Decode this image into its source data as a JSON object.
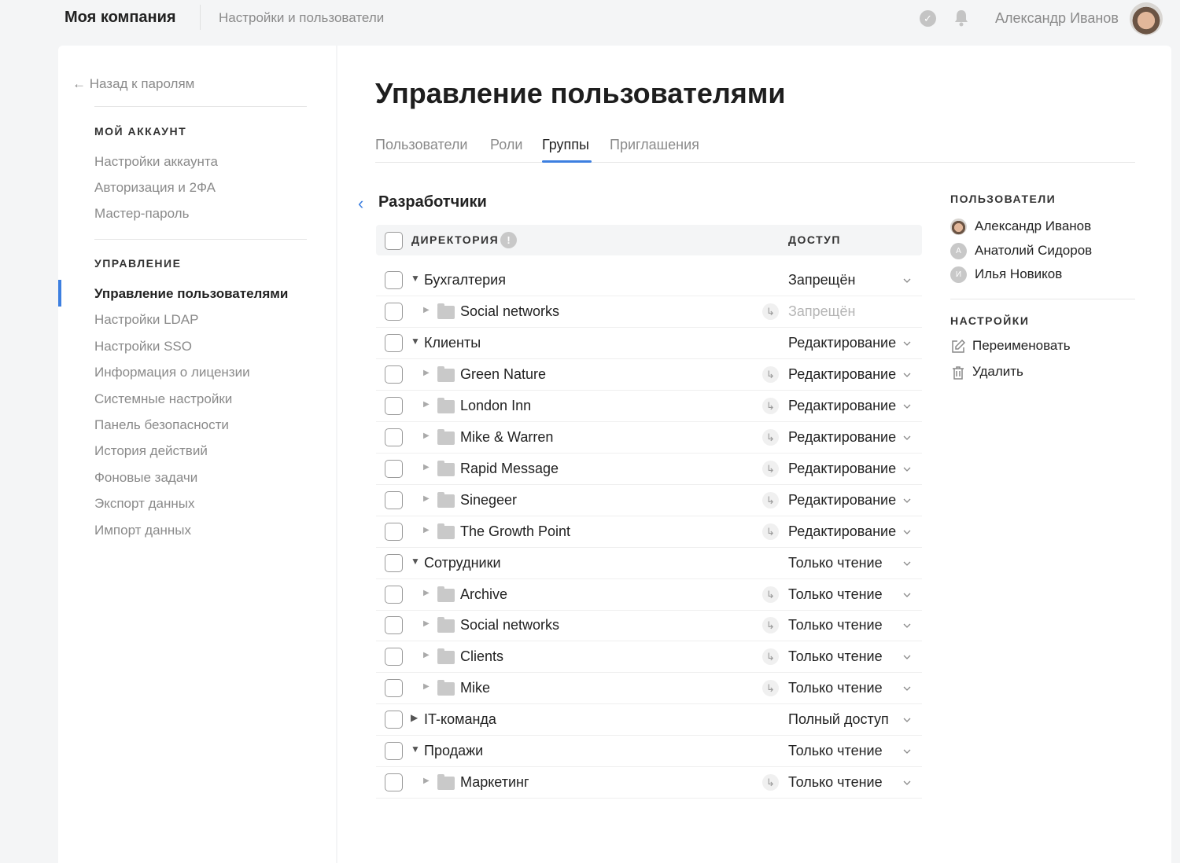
{
  "header": {
    "brand": "Моя компания",
    "section": "Настройки и пользователи",
    "user": "Александр Иванов"
  },
  "sidebar": {
    "back": "Назад к паролям",
    "account_heading": "МОЙ АККАУНТ",
    "account_items": [
      "Настройки аккаунта",
      "Авторизация и 2ФА",
      "Мастер-пароль"
    ],
    "manage_heading": "УПРАВЛЕНИЕ",
    "manage_items": [
      "Управление пользователями",
      "Настройки LDAP",
      "Настройки SSO",
      "Информация о лицензии",
      "Системные настройки",
      "Панель безопасности",
      "История действий",
      "Фоновые задачи",
      "Экспорт данных",
      "Импорт данных"
    ]
  },
  "main": {
    "title": "Управление пользователями",
    "tabs": [
      "Пользователи",
      "Роли",
      "Группы",
      "Приглашения"
    ],
    "active_tab": "Группы",
    "group_title": "Разработчики",
    "table": {
      "col_directory": "ДИРЕКТОРИЯ",
      "col_access": "ДОСТУП",
      "rows": [
        {
          "name": "Бухгалтерия",
          "level": 0,
          "expanded": true,
          "access": "Запрещён",
          "inherited": false,
          "dim": false
        },
        {
          "name": "Social networks",
          "level": 1,
          "access": "Запрещён",
          "inherited": true,
          "dim": true
        },
        {
          "name": "Клиенты",
          "level": 0,
          "expanded": true,
          "access": "Редактирование",
          "inherited": false
        },
        {
          "name": "Green Nature",
          "level": 1,
          "access": "Редактирование",
          "inherited": true
        },
        {
          "name": "London Inn",
          "level": 1,
          "access": "Редактирование",
          "inherited": true
        },
        {
          "name": "Mike & Warren",
          "level": 1,
          "access": "Редактирование",
          "inherited": true
        },
        {
          "name": "Rapid Message",
          "level": 1,
          "access": "Редактирование",
          "inherited": true
        },
        {
          "name": "Sinegeer",
          "level": 1,
          "access": "Редактирование",
          "inherited": true
        },
        {
          "name": "The Growth Point",
          "level": 1,
          "access": "Редактирование",
          "inherited": true
        },
        {
          "name": "Сотрудники",
          "level": 0,
          "expanded": true,
          "access": "Только чтение",
          "inherited": false
        },
        {
          "name": "Archive",
          "level": 1,
          "access": "Только чтение",
          "inherited": true
        },
        {
          "name": "Social networks",
          "level": 1,
          "access": "Только чтение",
          "inherited": true
        },
        {
          "name": "Clients",
          "level": 1,
          "access": "Только чтение",
          "inherited": true
        },
        {
          "name": "Mike",
          "level": 1,
          "access": "Только чтение",
          "inherited": true
        },
        {
          "name": "IT-команда",
          "level": 0,
          "expanded": false,
          "access": "Полный доступ",
          "inherited": false
        },
        {
          "name": "Продажи",
          "level": 0,
          "expanded": true,
          "access": "Только чтение",
          "inherited": false
        },
        {
          "name": "Маркетинг",
          "level": 1,
          "access": "Только чтение",
          "inherited": true
        }
      ]
    }
  },
  "right": {
    "users_heading": "ПОЛЬЗОВАТЕЛИ",
    "users": [
      {
        "name": "Александр Иванов",
        "initial": ""
      },
      {
        "name": "Анатолий Сидоров",
        "initial": "А"
      },
      {
        "name": "Илья Новиков",
        "initial": "И"
      }
    ],
    "settings_heading": "НАСТРОЙКИ",
    "rename": "Переименовать",
    "delete": "Удалить"
  },
  "colors": {
    "accent": "#3d7fe0"
  }
}
